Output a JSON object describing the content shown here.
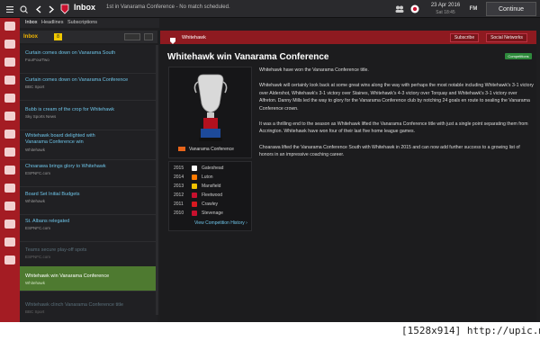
{
  "topbar": {
    "section_title": "Inbox",
    "status_text": "1st in Vanarama Conference - No match scheduled.",
    "date": "23 Apr 2016",
    "time": "Sat 18:45",
    "continue_label": "Continue"
  },
  "tabs": [
    "Inbox",
    "Headlines",
    "Subscriptions"
  ],
  "inbox": {
    "title": "Inbox",
    "count": "8"
  },
  "messages": [
    {
      "title": "Curtain comes down on Vanarama South",
      "source": "FourFourTwo"
    },
    {
      "title": "Curtain comes down on Vanarama Conference",
      "source": "BBC Sport"
    },
    {
      "title": "Bubb is cream of the crop for Whitehawk",
      "source": "Sky Sports News"
    },
    {
      "title": "Whitehawk board delighted with Vanarama Conference win",
      "source": "Whitehawk"
    },
    {
      "title": "Choarawa brings glory to Whitehawk",
      "source": "ESPNFC.com"
    },
    {
      "title": "Board Set Initial Budgets",
      "source": "Whitehawk"
    },
    {
      "title": "St. Albans relegated",
      "source": "ESPNFC.com"
    },
    {
      "title": "Teams secure play-off spots",
      "source": "ESPNFC.com"
    },
    {
      "title": "Whitehawk win Vanarama Conference",
      "source": "Whitehawk"
    },
    {
      "title": "Whitehawk clinch Vanarama Conference title",
      "source": "BBC Sport"
    }
  ],
  "main": {
    "club_name": "Whitehawk",
    "subscribe_label": "Subscribe",
    "social_label": "Social Networks",
    "headline": "Whitehawk win Vanarama Conference",
    "badge": "Competitions",
    "trophy_caption": "Vanarama Conference",
    "winners": [
      {
        "year": "2015",
        "team": "Gateshead",
        "color": "#ffffff"
      },
      {
        "year": "2014",
        "team": "Luton",
        "color": "#ff7a00"
      },
      {
        "year": "2013",
        "team": "Mansfield",
        "color": "#f2c200"
      },
      {
        "year": "2012",
        "team": "Fleetwood",
        "color": "#c8102e"
      },
      {
        "year": "2011",
        "team": "Crawley",
        "color": "#d71920"
      },
      {
        "year": "2010",
        "team": "Stevenage",
        "color": "#c8102e"
      }
    ],
    "view_history": "View Competition History ›",
    "article": [
      "Whitehawk have won the Vanarama Conference title.",
      "Whitehawk will certainly look back at some great wins along the way with perhaps the most notable including Whitehawk's 3-1 victory over Aldershot, Whitehawk's 3-1 victory over Staines, Whitehawk's 4-3 victory over Torquay and Whitehawk's 3-1 victory over Alfreton. Danny Mills led the way to glory for the Vanarama Conference club by notching 24 goals en route to sealing the Vanarama Conference crown.",
      "It was a thrilling end to the season as Whitehawk lifted the Vanarama Conference title with just a single point separating them from Accrington. Whitehawk have won four of their last five home league games.",
      "Choarawa lifted the Vanarama Conference South with Whitehawk in 2015 and can now add further success to a growing list of honors in an impressive coaching career."
    ]
  },
  "watermark": "[1528x914] http://upic.me/"
}
